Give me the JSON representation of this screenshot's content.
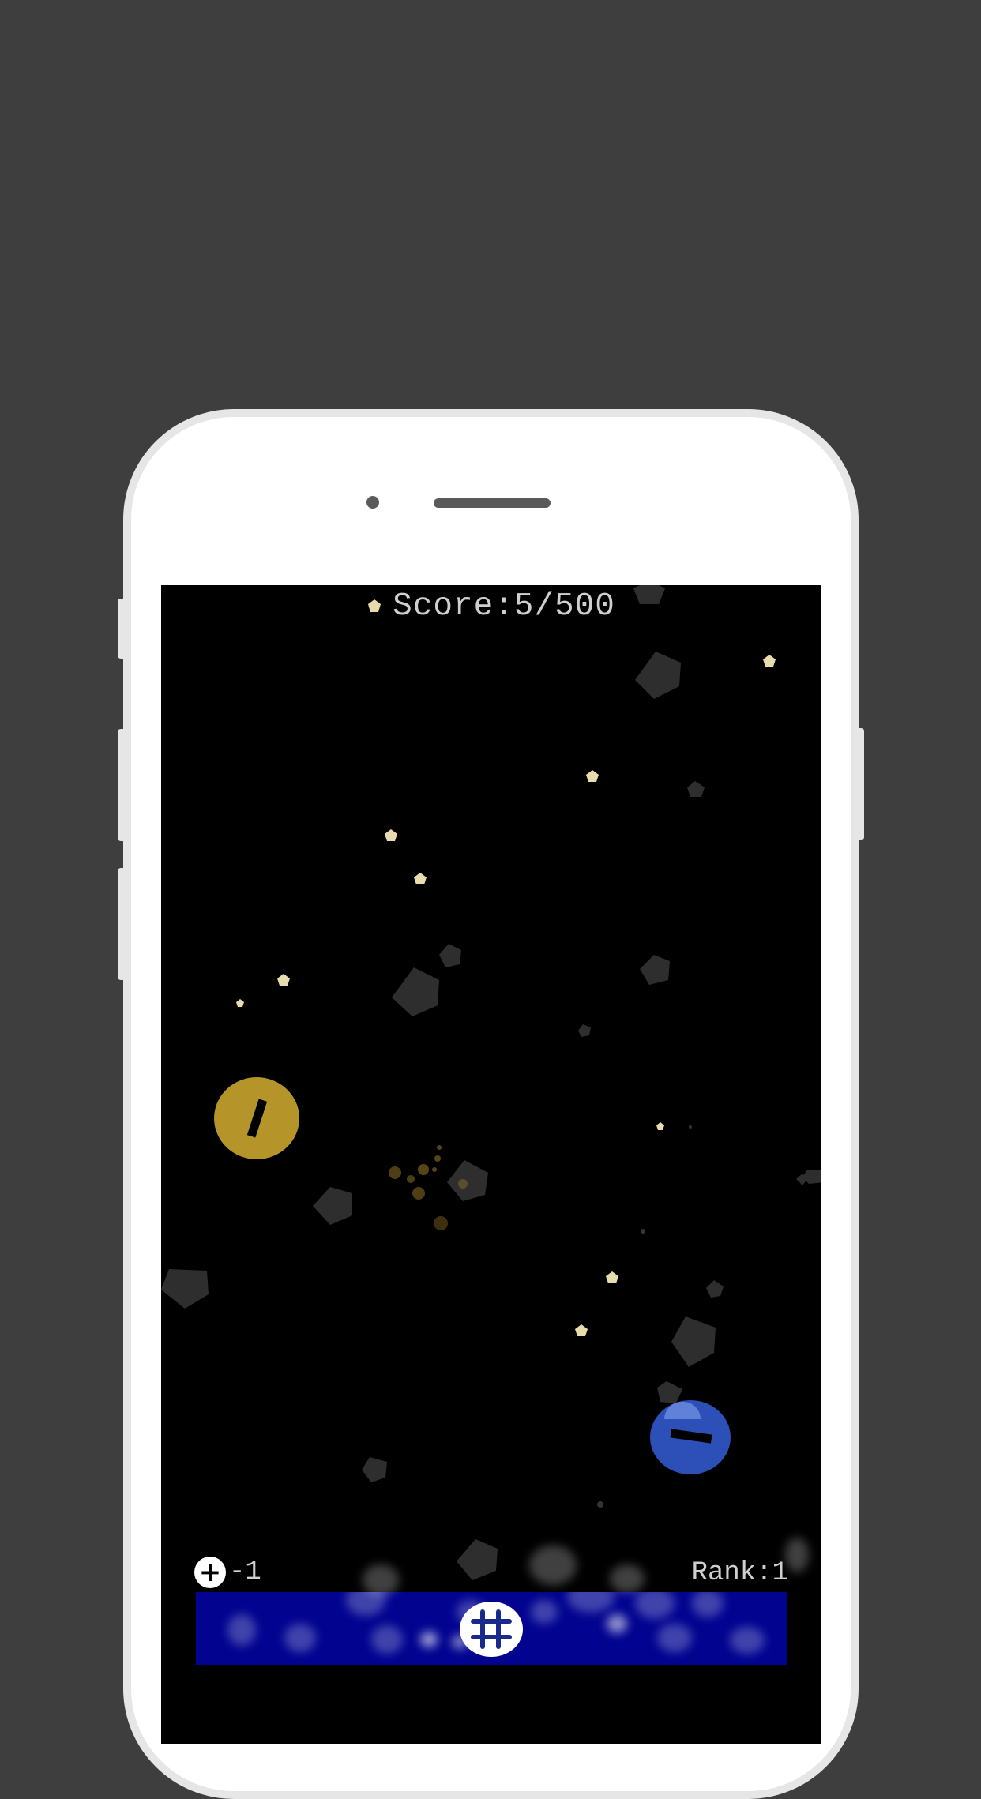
{
  "hud": {
    "score_text": "Score:5/500",
    "lives_icon": "+",
    "lives_text": "-1",
    "rank_text": "Rank:1"
  },
  "colors": {
    "background": "#3e3e3e",
    "screen": "#000000",
    "star": "#e8dcae",
    "rock": "#3a3a3a",
    "yellow_ball": "#b5952a",
    "blue_ball": "#2c4fb8",
    "bar": "#020490"
  },
  "icons": {
    "score": "pentagon-star-icon",
    "lives": "plus-circle-icon",
    "menu": "grid-icon"
  }
}
